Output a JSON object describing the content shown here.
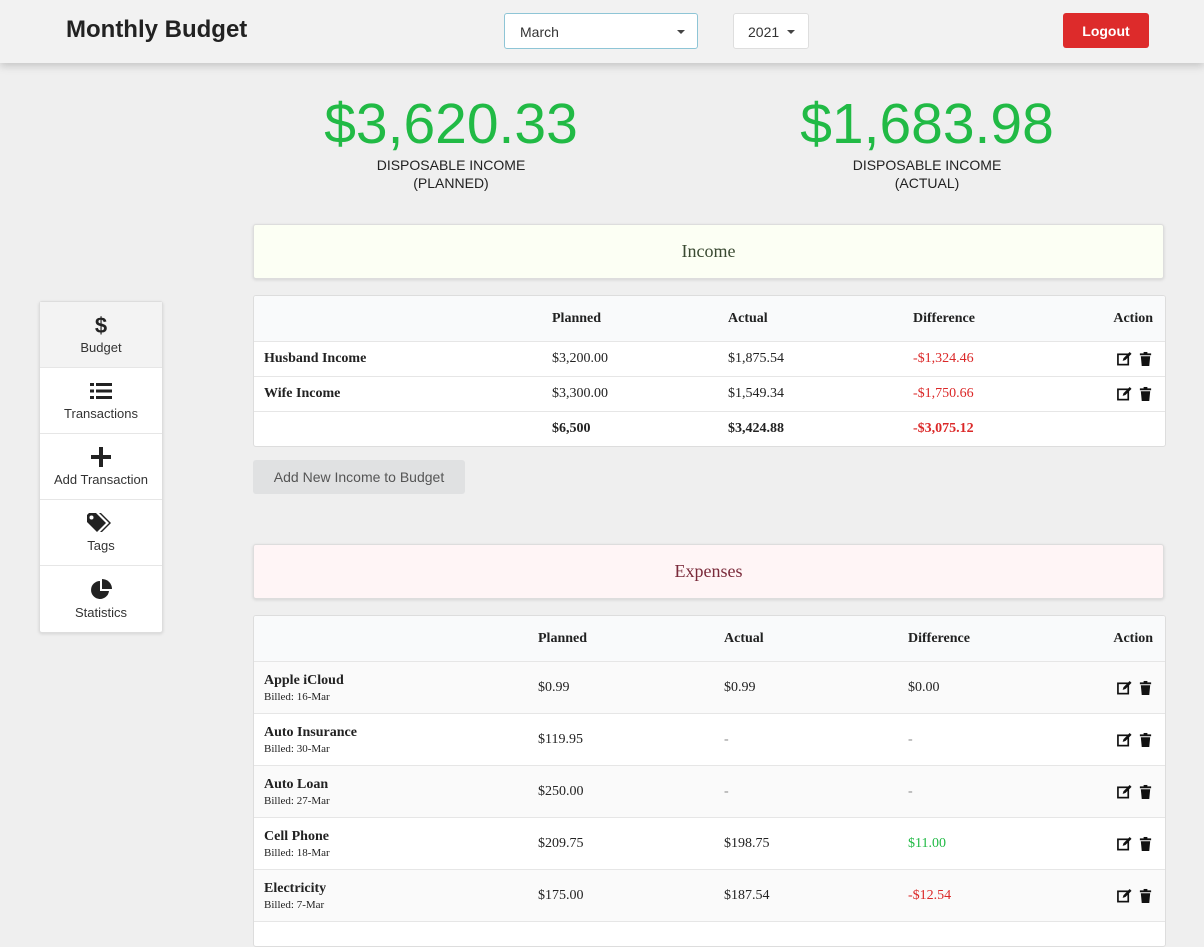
{
  "header": {
    "title": "Monthly Budget",
    "month_select": "March",
    "year_select": "2021",
    "logout_label": "Logout"
  },
  "summary": {
    "planned": {
      "amount": "$3,620.33",
      "label_line1": "DISPOSABLE INCOME",
      "label_line2": "(PLANNED)"
    },
    "actual": {
      "amount": "$1,683.98",
      "label_line1": "DISPOSABLE INCOME",
      "label_line2": "(ACTUAL)"
    }
  },
  "sidebar": {
    "items": [
      {
        "label": "Budget",
        "icon": "dollar-icon"
      },
      {
        "label": "Transactions",
        "icon": "list-icon"
      },
      {
        "label": "Add Transaction",
        "icon": "plus-icon"
      },
      {
        "label": "Tags",
        "icon": "tags-icon"
      },
      {
        "label": "Statistics",
        "icon": "pie-chart-icon"
      }
    ]
  },
  "income": {
    "title": "Income",
    "columns": {
      "planned": "Planned",
      "actual": "Actual",
      "difference": "Difference",
      "action": "Action"
    },
    "rows": [
      {
        "name": "Husband Income",
        "planned": "$3,200.00",
        "actual": "$1,875.54",
        "difference": "-$1,324.46"
      },
      {
        "name": "Wife Income",
        "planned": "$3,300.00",
        "actual": "$1,549.34",
        "difference": "-$1,750.66"
      }
    ],
    "total": {
      "planned": "$6,500",
      "actual": "$3,424.88",
      "difference": "-$3,075.12"
    },
    "add_button": "Add New Income to Budget"
  },
  "expenses": {
    "title": "Expenses",
    "columns": {
      "planned": "Planned",
      "actual": "Actual",
      "difference": "Difference",
      "action": "Action"
    },
    "rows": [
      {
        "name": "Apple iCloud",
        "billed": "Billed: 16-Mar",
        "planned": "$0.99",
        "actual": "$0.99",
        "difference": "$0.00"
      },
      {
        "name": "Auto Insurance",
        "billed": "Billed: 30-Mar",
        "planned": "$119.95",
        "actual": "-",
        "difference": "-"
      },
      {
        "name": "Auto Loan",
        "billed": "Billed: 27-Mar",
        "planned": "$250.00",
        "actual": "-",
        "difference": "-"
      },
      {
        "name": "Cell Phone",
        "billed": "Billed: 18-Mar",
        "planned": "$209.75",
        "actual": "$198.75",
        "difference": "$11.00"
      },
      {
        "name": "Electricity",
        "billed": "Billed: 7-Mar",
        "planned": "$175.00",
        "actual": "$187.54",
        "difference": "-$12.54"
      }
    ]
  },
  "colors": {
    "accent_green": "#21ba45",
    "negative_red": "#db2828",
    "logout_red": "#dd2b2b"
  }
}
